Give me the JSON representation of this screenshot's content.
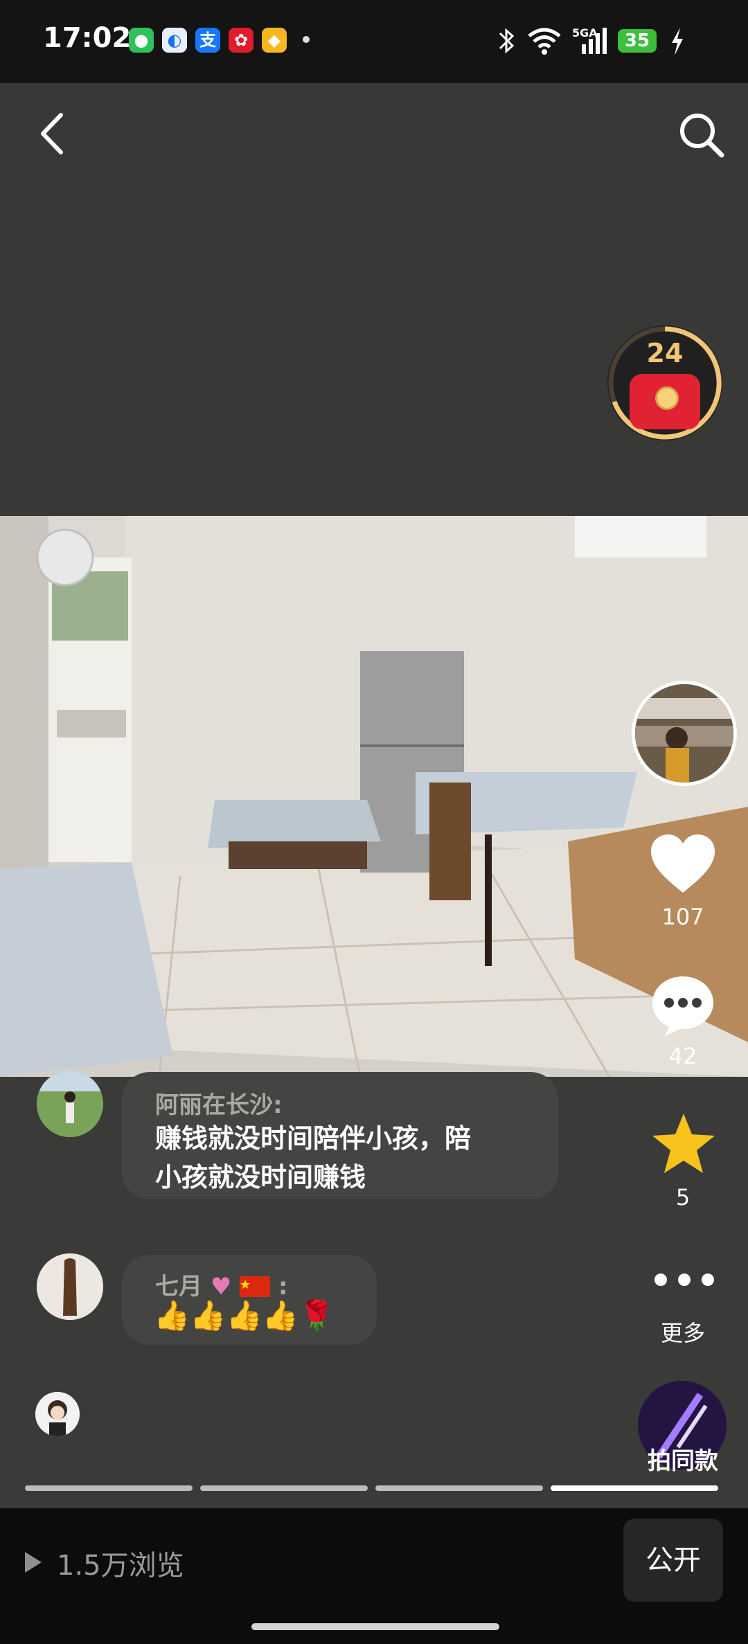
{
  "status_bar": {
    "time": "17:02",
    "network": "5GA",
    "battery": "35",
    "app_icons": [
      "wechat-icon",
      "browser-icon",
      "alipay-icon",
      "taobao-icon",
      "coupon-icon"
    ]
  },
  "red_packet": {
    "count": "24"
  },
  "actions": {
    "likes": "107",
    "comments": "42",
    "favorites": "5",
    "more_label": "更多",
    "same_style_label": "拍同款"
  },
  "comments": [
    {
      "author": "阿丽在长沙:",
      "text_line1": "赚钱就没时间陪伴小孩，陪",
      "text_line2": "小孩就没时间赚钱"
    },
    {
      "author": "七月",
      "author_suffix": ":",
      "emojis": "👍👍👍👍🌹"
    }
  ],
  "progress": {
    "segments": 4,
    "active_index": 3
  },
  "bottom": {
    "views": "1.5万浏览",
    "public_label": "公开"
  },
  "colors": {
    "like": "#ffffff",
    "star": "#f7c21c",
    "red_packet": "#e02233",
    "ring": "#f2c579"
  }
}
